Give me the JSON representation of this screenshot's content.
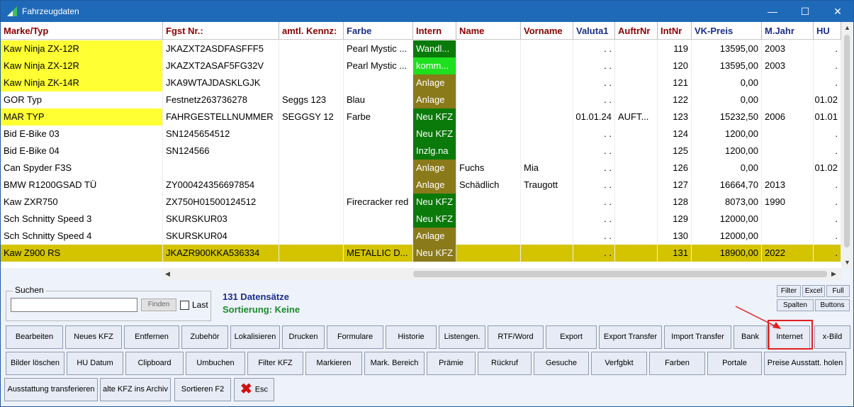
{
  "window": {
    "title": "Fahrzeugdaten",
    "controls": {
      "minimize": "—",
      "maximize": "☐",
      "close": "✕"
    }
  },
  "columns": [
    {
      "label": "Marke/Typ",
      "color": "#8b0000"
    },
    {
      "label": "Fgst Nr.:",
      "color": "#8b0000"
    },
    {
      "label": "amtl. Kennz:",
      "color": "#8b0000"
    },
    {
      "label": "Farbe",
      "color": "#1a2f8a"
    },
    {
      "label": "Intern",
      "color": "#8b0000"
    },
    {
      "label": "Name",
      "color": "#8b0000"
    },
    {
      "label": "Vorname",
      "color": "#8b0000"
    },
    {
      "label": "Valuta1",
      "color": "#1a2f8a"
    },
    {
      "label": "AuftrNr",
      "color": "#8b0000"
    },
    {
      "label": "IntNr",
      "color": "#8b0000"
    },
    {
      "label": "VK-Preis",
      "color": "#1a2f8a"
    },
    {
      "label": "M.Jahr",
      "color": "#1a2f8a"
    },
    {
      "label": "HU",
      "color": "#1a2f8a"
    }
  ],
  "rows": [
    {
      "marke": "Kaw Ninja ZX-12R",
      "fgst": "JKAZXT2ASDFASFFF5",
      "kennz": "",
      "farbe": "Pearl Mystic ...",
      "intern": "Wandl...",
      "name": "",
      "vorname": "",
      "valuta": ". .",
      "auftr": "",
      "intnr": "119",
      "vk": "13595,00",
      "mjahr": "2003",
      "hu": ".",
      "highlight": true,
      "intern_color": "#0a7a0a"
    },
    {
      "marke": "Kaw Ninja ZX-12R",
      "fgst": "JKAZXT2ASAF5FG32V",
      "kennz": "",
      "farbe": "Pearl Mystic ...",
      "intern": "komm...",
      "name": "",
      "vorname": "",
      "valuta": ". .",
      "auftr": "",
      "intnr": "120",
      "vk": "13595,00",
      "mjahr": "2003",
      "hu": ".",
      "highlight": true,
      "intern_color": "#1fe01f"
    },
    {
      "marke": "Kaw Ninja ZK-14R",
      "fgst": "JKA9WTAJDASKLGJK",
      "kennz": "",
      "farbe": "",
      "intern": "Anlage",
      "name": "",
      "vorname": "",
      "valuta": ". .",
      "auftr": "",
      "intnr": "121",
      "vk": "0,00",
      "mjahr": "",
      "hu": ".",
      "highlight": true,
      "intern_color": "#8a7a1a"
    },
    {
      "marke": "GOR Typ",
      "fgst": "Festnetz263736278",
      "kennz": "Seggs 123",
      "farbe": "Blau",
      "intern": "Anlage",
      "name": "",
      "vorname": "",
      "valuta": ". .",
      "auftr": "",
      "intnr": "122",
      "vk": "0,00",
      "mjahr": "",
      "hu": "01.02",
      "highlight": false,
      "intern_color": "#8a7a1a"
    },
    {
      "marke": "MAR TYP",
      "fgst": "FAHRGESTELLNUMMER",
      "kennz": "SEGGSY 12",
      "farbe": "Farbe",
      "intern": "Neu KFZ",
      "name": "",
      "vorname": "",
      "valuta": "01.01.24",
      "auftr": "AUFT...",
      "intnr": "123",
      "vk": "15232,50",
      "mjahr": "2006",
      "hu": "01.01",
      "highlight": true,
      "intern_color": "#0a7a0a"
    },
    {
      "marke": "Bid E-Bike 03",
      "fgst": "SN1245654512",
      "kennz": "",
      "farbe": "",
      "intern": "Neu KFZ",
      "name": "",
      "vorname": "",
      "valuta": ". .",
      "auftr": "",
      "intnr": "124",
      "vk": "1200,00",
      "mjahr": "",
      "hu": ".",
      "highlight": false,
      "intern_color": "#0a7a0a"
    },
    {
      "marke": "Bid E-Bike 04",
      "fgst": "SN124566",
      "kennz": "",
      "farbe": "",
      "intern": "Inzlg.na",
      "name": "",
      "vorname": "",
      "valuta": ". .",
      "auftr": "",
      "intnr": "125",
      "vk": "1200,00",
      "mjahr": "",
      "hu": ".",
      "highlight": false,
      "intern_color": "#0a7a0a"
    },
    {
      "marke": "Can Spyder F3S",
      "fgst": "",
      "kennz": "",
      "farbe": "",
      "intern": "Anlage",
      "name": "Fuchs",
      "vorname": "Mia",
      "valuta": ". .",
      "auftr": "",
      "intnr": "126",
      "vk": "0,00",
      "mjahr": "",
      "hu": "01.02",
      "highlight": false,
      "intern_color": "#8a7a1a"
    },
    {
      "marke": "BMW R1200GSAD TÜ",
      "fgst": "ZY000424356697854",
      "kennz": "",
      "farbe": "",
      "intern": "Anlage",
      "name": "Schädlich",
      "vorname": "Traugott",
      "valuta": ". .",
      "auftr": "",
      "intnr": "127",
      "vk": "16664,70",
      "mjahr": "2013",
      "hu": ".",
      "highlight": false,
      "intern_color": "#8a7a1a"
    },
    {
      "marke": "Kaw ZXR750",
      "fgst": "ZX750H01500124512",
      "kennz": "",
      "farbe": "Firecracker red",
      "intern": "Neu KFZ",
      "name": "",
      "vorname": "",
      "valuta": ". .",
      "auftr": "",
      "intnr": "128",
      "vk": "8073,00",
      "mjahr": "1990",
      "hu": ".",
      "highlight": false,
      "intern_color": "#0a7a0a"
    },
    {
      "marke": "Sch Schnitty Speed 3",
      "fgst": "SKURSKUR03",
      "kennz": "",
      "farbe": "",
      "intern": "Neu KFZ",
      "name": "",
      "vorname": "",
      "valuta": ". .",
      "auftr": "",
      "intnr": "129",
      "vk": "12000,00",
      "mjahr": "",
      "hu": ".",
      "highlight": false,
      "intern_color": "#0a7a0a"
    },
    {
      "marke": "Sch Schnitty Speed 4",
      "fgst": "SKURSKUR04",
      "kennz": "",
      "farbe": "",
      "intern": "Anlage",
      "name": "",
      "vorname": "",
      "valuta": ". .",
      "auftr": "",
      "intnr": "130",
      "vk": "12000,00",
      "mjahr": "",
      "hu": ".",
      "highlight": false,
      "intern_color": "#8a7a1a"
    },
    {
      "marke": "Kaw Z900 RS",
      "fgst": "JKAZR900KKA536334",
      "kennz": "",
      "farbe": "METALLIC D...",
      "intern": "Neu KFZ",
      "name": "",
      "vorname": "",
      "valuta": ". .",
      "auftr": "",
      "intnr": "131",
      "vk": "18900,00",
      "mjahr": "2022",
      "hu": ".",
      "highlight": true,
      "selected": true,
      "intern_color": "#8a7a1a"
    }
  ],
  "search": {
    "legend": "Suchen",
    "value": "",
    "find_label": "Finden",
    "last_label": "Last"
  },
  "status": {
    "count": "131 Datensätze",
    "sort": "Sortierung: Keine"
  },
  "small_buttons": {
    "filter": "Filter",
    "excel": "Excel",
    "full": "Full",
    "spalten": "Spalten",
    "buttons": "Buttons"
  },
  "buttons_row1": [
    "Bearbeiten",
    "Neues KFZ",
    "Entfernen",
    "Zubehör",
    "Lokalisieren",
    "Drucken",
    "Formulare",
    "Historie",
    "Listengen.",
    "RTF/Word",
    "Export",
    "Export Transfer",
    "Import Transfer",
    "Bank",
    "Internet",
    "x-Bild"
  ],
  "buttons_row2": [
    "Bilder löschen",
    "HU Datum",
    "Clipboard",
    "Umbuchen",
    "Filter KFZ",
    "Markieren",
    "Mark. Bereich",
    "Prämie",
    "Rückruf",
    "Gesuche",
    "Verfgbkt",
    "Farben",
    "Portale",
    "Preise Ausstatt. holen"
  ],
  "buttons_row3": [
    "Ausstattung transferieren",
    "alte KFZ ins Archiv",
    "Sortieren F2",
    "Esc"
  ],
  "colors": {
    "highlight": "#ffff33",
    "selected": "#d4c400",
    "header_red": "#8b0000",
    "header_blue": "#1a2f8a",
    "annotation": "#e02020"
  }
}
